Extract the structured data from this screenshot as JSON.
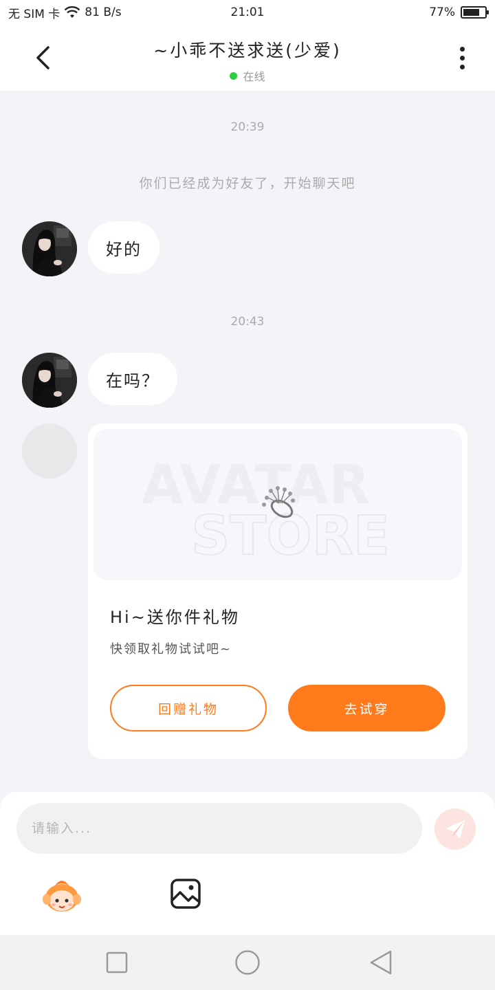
{
  "status_bar": {
    "sim": "无 SIM 卡",
    "speed": "81 B/s",
    "time": "21:01",
    "battery": "77%",
    "battery_level": 0.77
  },
  "header": {
    "title": "~小乖不送求送(少爱)",
    "status": "在线",
    "status_color": "#2ecc40"
  },
  "chat": {
    "timestamp_1": "20:39",
    "system_message": "你们已经成为好友了，开始聊天吧",
    "message_1": "好的",
    "timestamp_2": "20:43",
    "message_2": "在吗？"
  },
  "gift_card": {
    "watermark_line1": "AVATAR",
    "watermark_line2": "STORE",
    "title": "Hi~送你件礼物",
    "subtitle": "快领取礼物试试吧~",
    "return_gift_button": "回赠礼物",
    "try_on_button": "去试穿"
  },
  "composer": {
    "placeholder": "请输入...",
    "accent_color": "#ff7a1a"
  },
  "icons": [
    "back-arrow-icon",
    "more-vertical-icon",
    "wifi-icon",
    "battery-icon",
    "send-icon",
    "emoji-mascot-icon",
    "image-icon",
    "nav-square-icon",
    "nav-circle-icon",
    "nav-triangle-icon"
  ]
}
